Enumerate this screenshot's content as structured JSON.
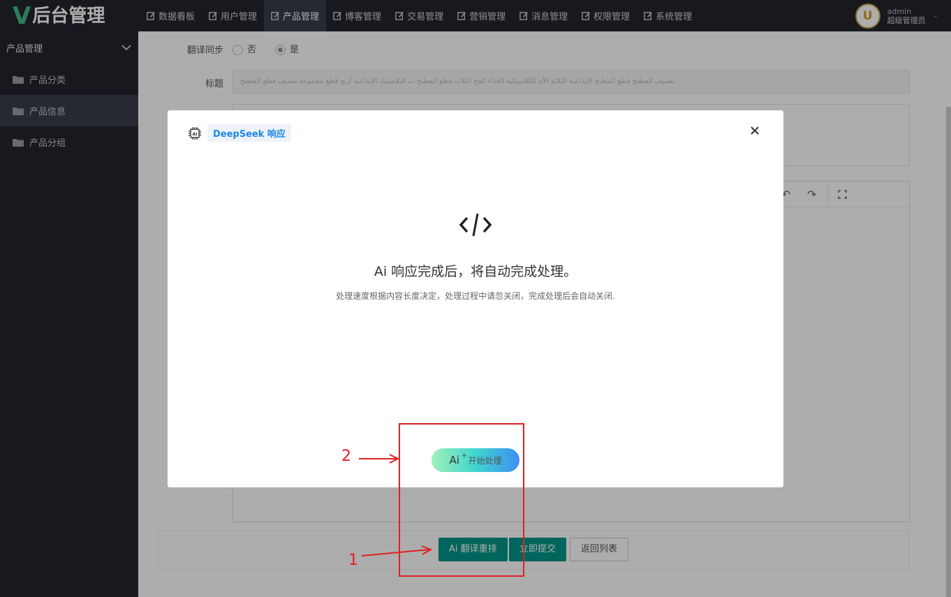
{
  "header": {
    "logo_letter": "V",
    "logo_text": "后台管理",
    "nav": [
      {
        "label": "数据看板"
      },
      {
        "label": "用户管理"
      },
      {
        "label": "产品管理"
      },
      {
        "label": "博客管理"
      },
      {
        "label": "交易管理"
      },
      {
        "label": "营销管理"
      },
      {
        "label": "消息管理"
      },
      {
        "label": "权限管理"
      },
      {
        "label": "系统管理"
      }
    ],
    "active_nav": "产品管理",
    "user": {
      "avatar_letter": "U",
      "name": "admin",
      "role": "超级管理员"
    }
  },
  "sidebar": {
    "title": "产品管理",
    "items": [
      {
        "label": "产品分类"
      },
      {
        "label": "产品信息"
      },
      {
        "label": "产品分组"
      }
    ],
    "active_item": "产品信息"
  },
  "form": {
    "sync_label": "翻译同步",
    "sync_options": [
      "否",
      "是"
    ],
    "sync_selected": "是",
    "title_label": "标题",
    "title_value": "تصنيف المطبخ قطع المطبخ الإبداعية الثلاثة الأم الكلاسيكية الغذاء الفخ الثلاث قطع المطبخ ب البلاستيك الإبداعية أربع قطع مجموعة تصنيف قطع المطبخ",
    "buttons": {
      "ai_translate": "Ai 翻译重排",
      "submit": "立即提交",
      "back": "返回列表"
    }
  },
  "modal": {
    "tag": "DeepSeek 响应",
    "title": "Ai 响应完成后，将自动完成处理。",
    "description": "处理速度根据内容长度决定，处理过程中请忽关闭，完成处理后会自动关闭.",
    "start_button": {
      "glyph": "Ai",
      "spark": "+",
      "label": "开始处理"
    }
  },
  "annotations": {
    "step1": "1",
    "step2": "2",
    "color": "#e02020"
  }
}
